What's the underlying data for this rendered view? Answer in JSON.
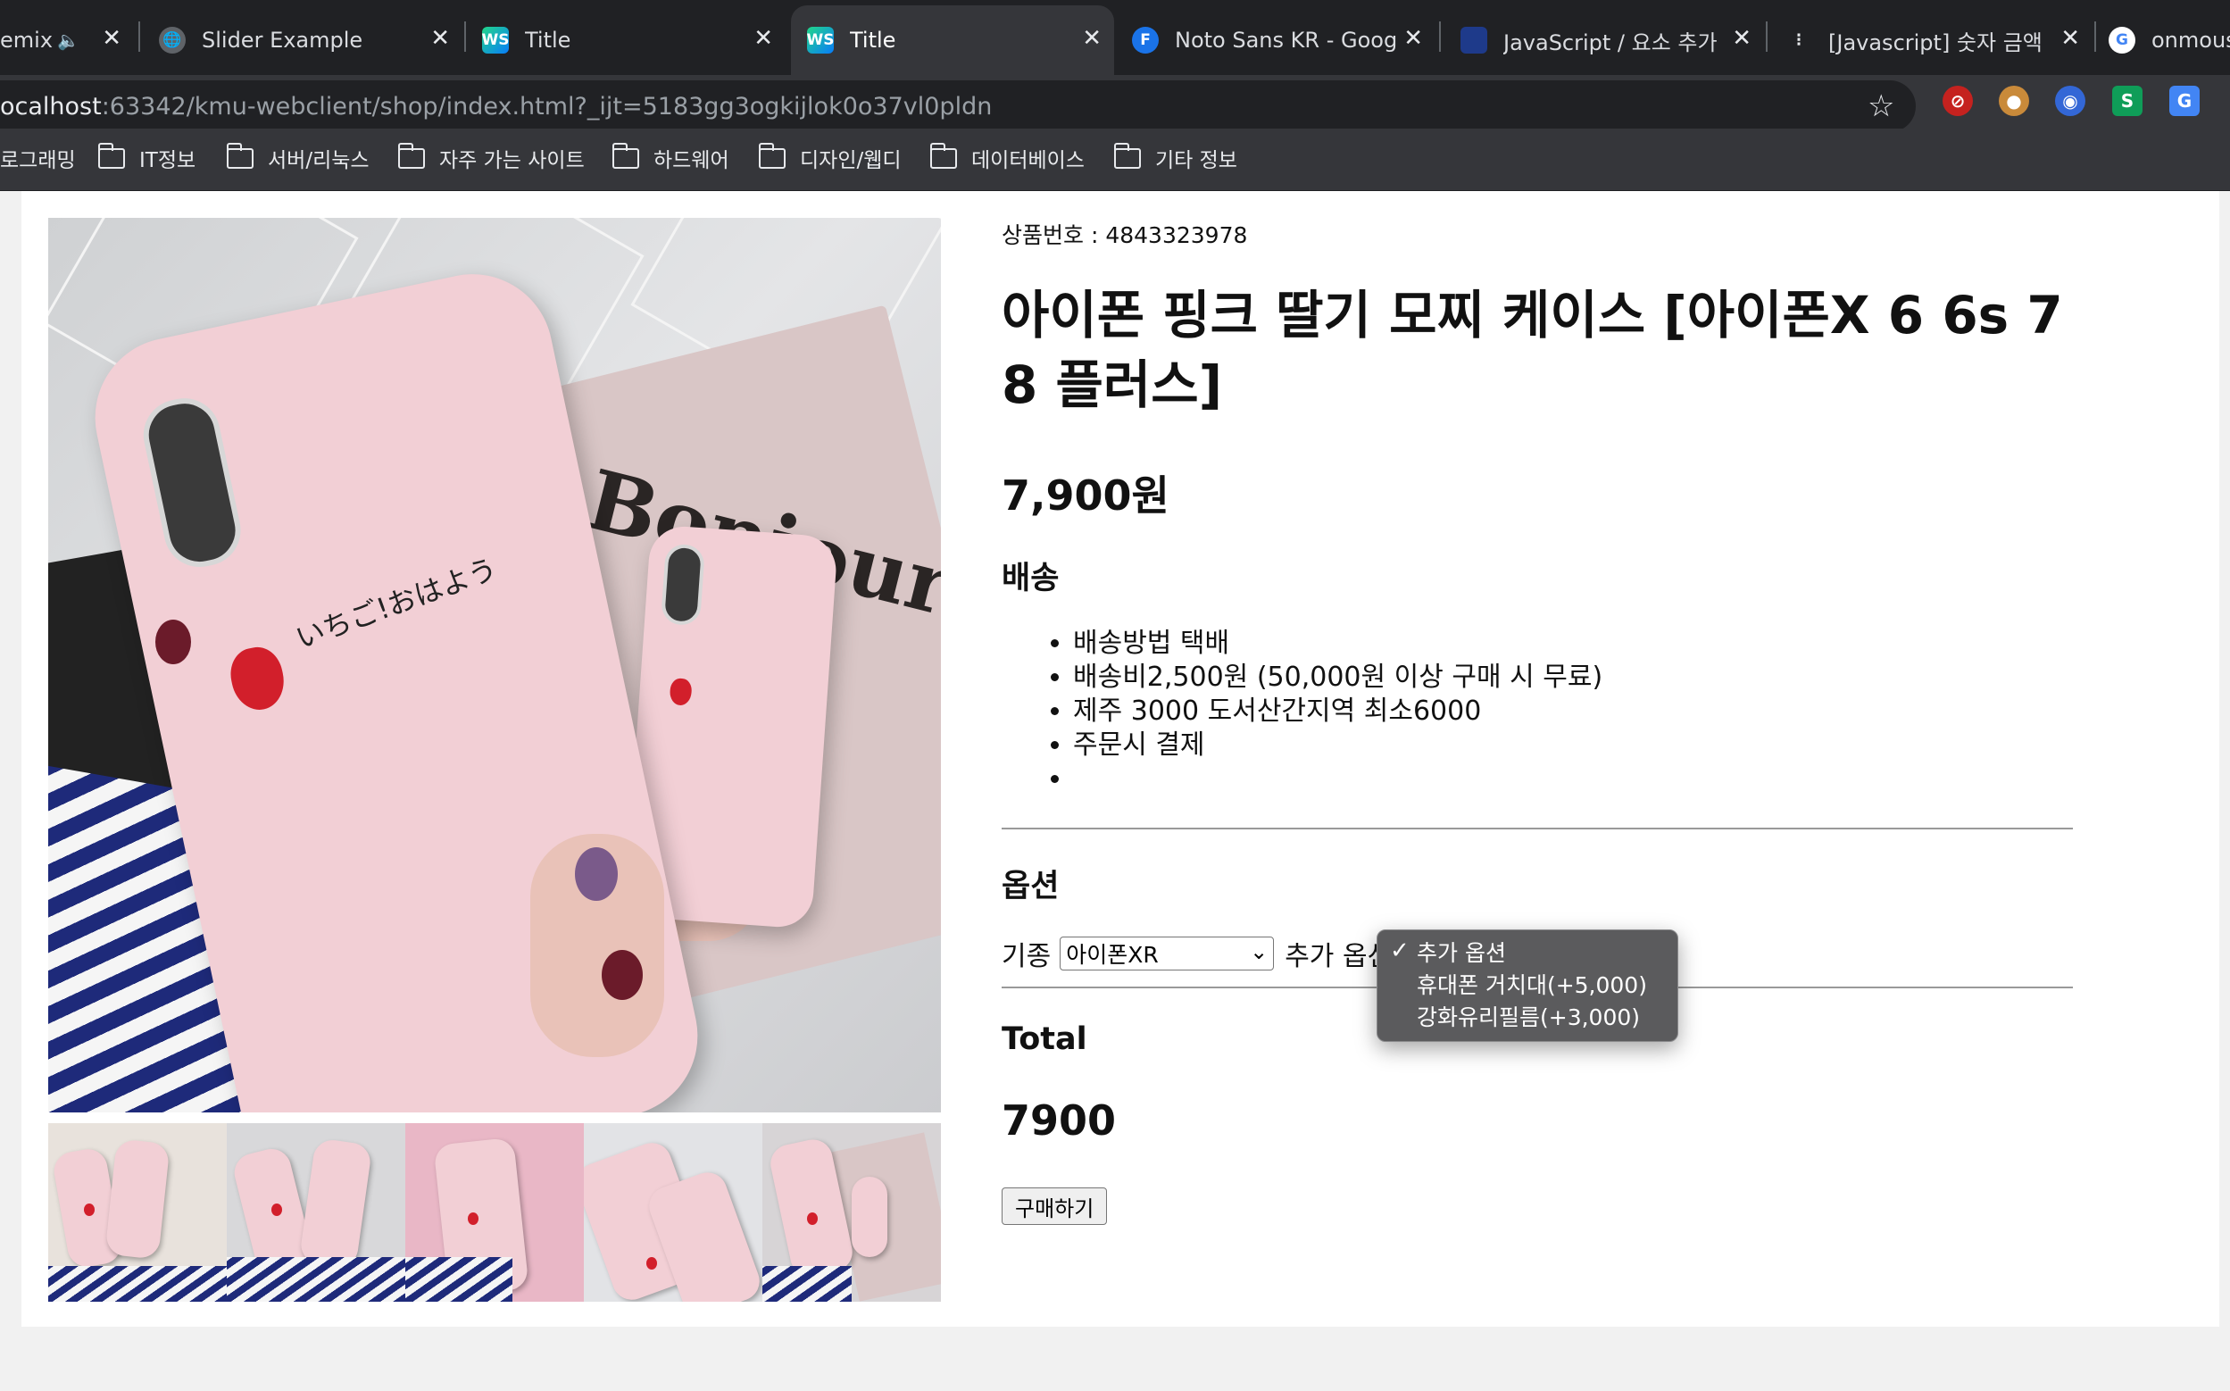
{
  "browser": {
    "tabs": [
      {
        "label": "emix",
        "icon": "speaker-icon",
        "active": false
      },
      {
        "label": "Slider Example",
        "icon": "globe-icon",
        "active": false
      },
      {
        "label": "Title",
        "icon": "webstorm-icon",
        "active": false
      },
      {
        "label": "Title",
        "icon": "webstorm-icon",
        "active": true
      },
      {
        "label": "Noto Sans KR - Goog",
        "icon": "fonts-icon",
        "active": false
      },
      {
        "label": "JavaScript / 요소 추가",
        "icon": "blog-icon",
        "active": false
      },
      {
        "label": "[Javascript] 숫자 금액",
        "icon": "tistory-icon",
        "active": false
      },
      {
        "label": "onmous",
        "icon": "google-icon",
        "active": false
      }
    ],
    "url_host": "ocalhost",
    "url_rest": ":63342/kmu-webclient/shop/index.html?_ijt=5183gg3ogkijlok0o37vl0pldn",
    "bookmarks": [
      "로그래밍",
      "IT정보",
      "서버/리눅스",
      "자주 가는 사이트",
      "하드웨어",
      "디자인/웹디",
      "데이터베이스",
      "기타 정보"
    ]
  },
  "product": {
    "number_text": "상품번호 : 4843323978",
    "title": "아이폰 핑크 딸기 모찌 케이스 [아이폰X 6 6s 7 8 플러스]",
    "price": "7,900원",
    "image_text": "Bonjour",
    "case_text": "いちご!おはよう"
  },
  "shipping": {
    "heading": "배송",
    "items": [
      "배송방법 택배",
      "배송비2,500원 (50,000원 이상 구매 시 무료)",
      "제주 3000 도서산간지역 최소6000",
      "주문시 결제",
      ""
    ]
  },
  "options": {
    "heading": "옵션",
    "model_label": "기종",
    "model_value": "아이폰XR",
    "extra_label": "추가 옵션",
    "dropdown": [
      {
        "label": "추가 옵션",
        "selected": true
      },
      {
        "label": "휴대폰 거치대(+5,000)",
        "selected": false
      },
      {
        "label": "강화유리필름(+3,000)",
        "selected": false
      }
    ]
  },
  "total": {
    "heading": "Total",
    "value": "7900"
  },
  "buy_button": "구매하기",
  "colors": {
    "chrome_dark": "#202124",
    "chrome_mid": "#35363a",
    "case_pink": "#f2cfd5"
  }
}
